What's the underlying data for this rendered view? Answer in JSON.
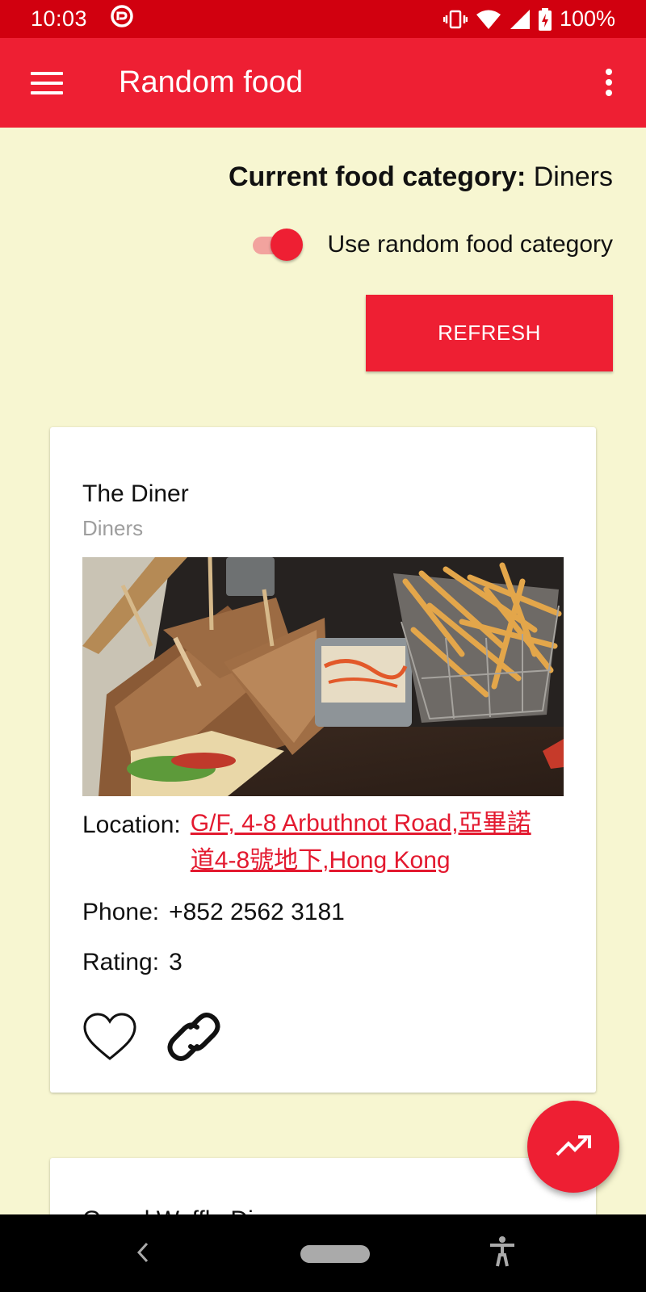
{
  "status_bar": {
    "time": "10:03",
    "battery": "100%",
    "icons": [
      "vpn-icon",
      "vibrate-icon",
      "wifi-icon",
      "signal-icon",
      "battery-charging-icon"
    ]
  },
  "app_bar": {
    "title": "Random food",
    "menu_icon": "hamburger-menu-icon",
    "overflow_icon": "more-vert-icon"
  },
  "header": {
    "category_label": "Current food category:",
    "category_value": "Diners",
    "toggle_label": "Use random food category",
    "toggle_on": true,
    "refresh_label": "REFRESH"
  },
  "card": {
    "title": "The Diner",
    "subtitle": "Diners",
    "location_label": "Location:",
    "location_value": "G/F, 4-8 Arbuthnot Road,亞畢諾道4-8號地下,Hong Kong",
    "phone_label": "Phone:",
    "phone_value": "+852 2562 3181",
    "rating_label": "Rating:",
    "rating_value": "3",
    "actions": [
      "heart-outline-icon",
      "link-icon"
    ]
  },
  "card2": {
    "title": "Grand Waffle Diner"
  },
  "fab": {
    "icon": "trending-up-icon"
  },
  "colors": {
    "status_bar": "#d1000f",
    "primary": "#ee1f33",
    "background": "#f7f6d1",
    "link": "#e3192f"
  }
}
